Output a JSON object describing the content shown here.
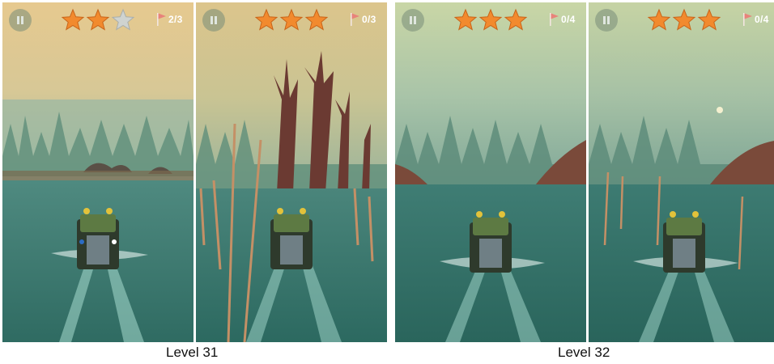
{
  "screenshots": [
    {
      "pause_icon": "pause-icon",
      "stars_earned": 2,
      "stars_total": 3,
      "flags": "2/3"
    },
    {
      "pause_icon": "pause-icon",
      "stars_earned": 3,
      "stars_total": 3,
      "flags": "0/3"
    },
    {
      "pause_icon": "pause-icon",
      "stars_earned": 3,
      "stars_total": 3,
      "flags": "0/4"
    },
    {
      "pause_icon": "pause-icon",
      "stars_earned": 3,
      "stars_total": 3,
      "flags": "0/4"
    }
  ],
  "captions": {
    "left": "Level 31",
    "right": "Level 32"
  },
  "colors": {
    "star_earned": "#f28a2e",
    "star_empty": "#cfd3d0",
    "flag": "#e8837a"
  }
}
